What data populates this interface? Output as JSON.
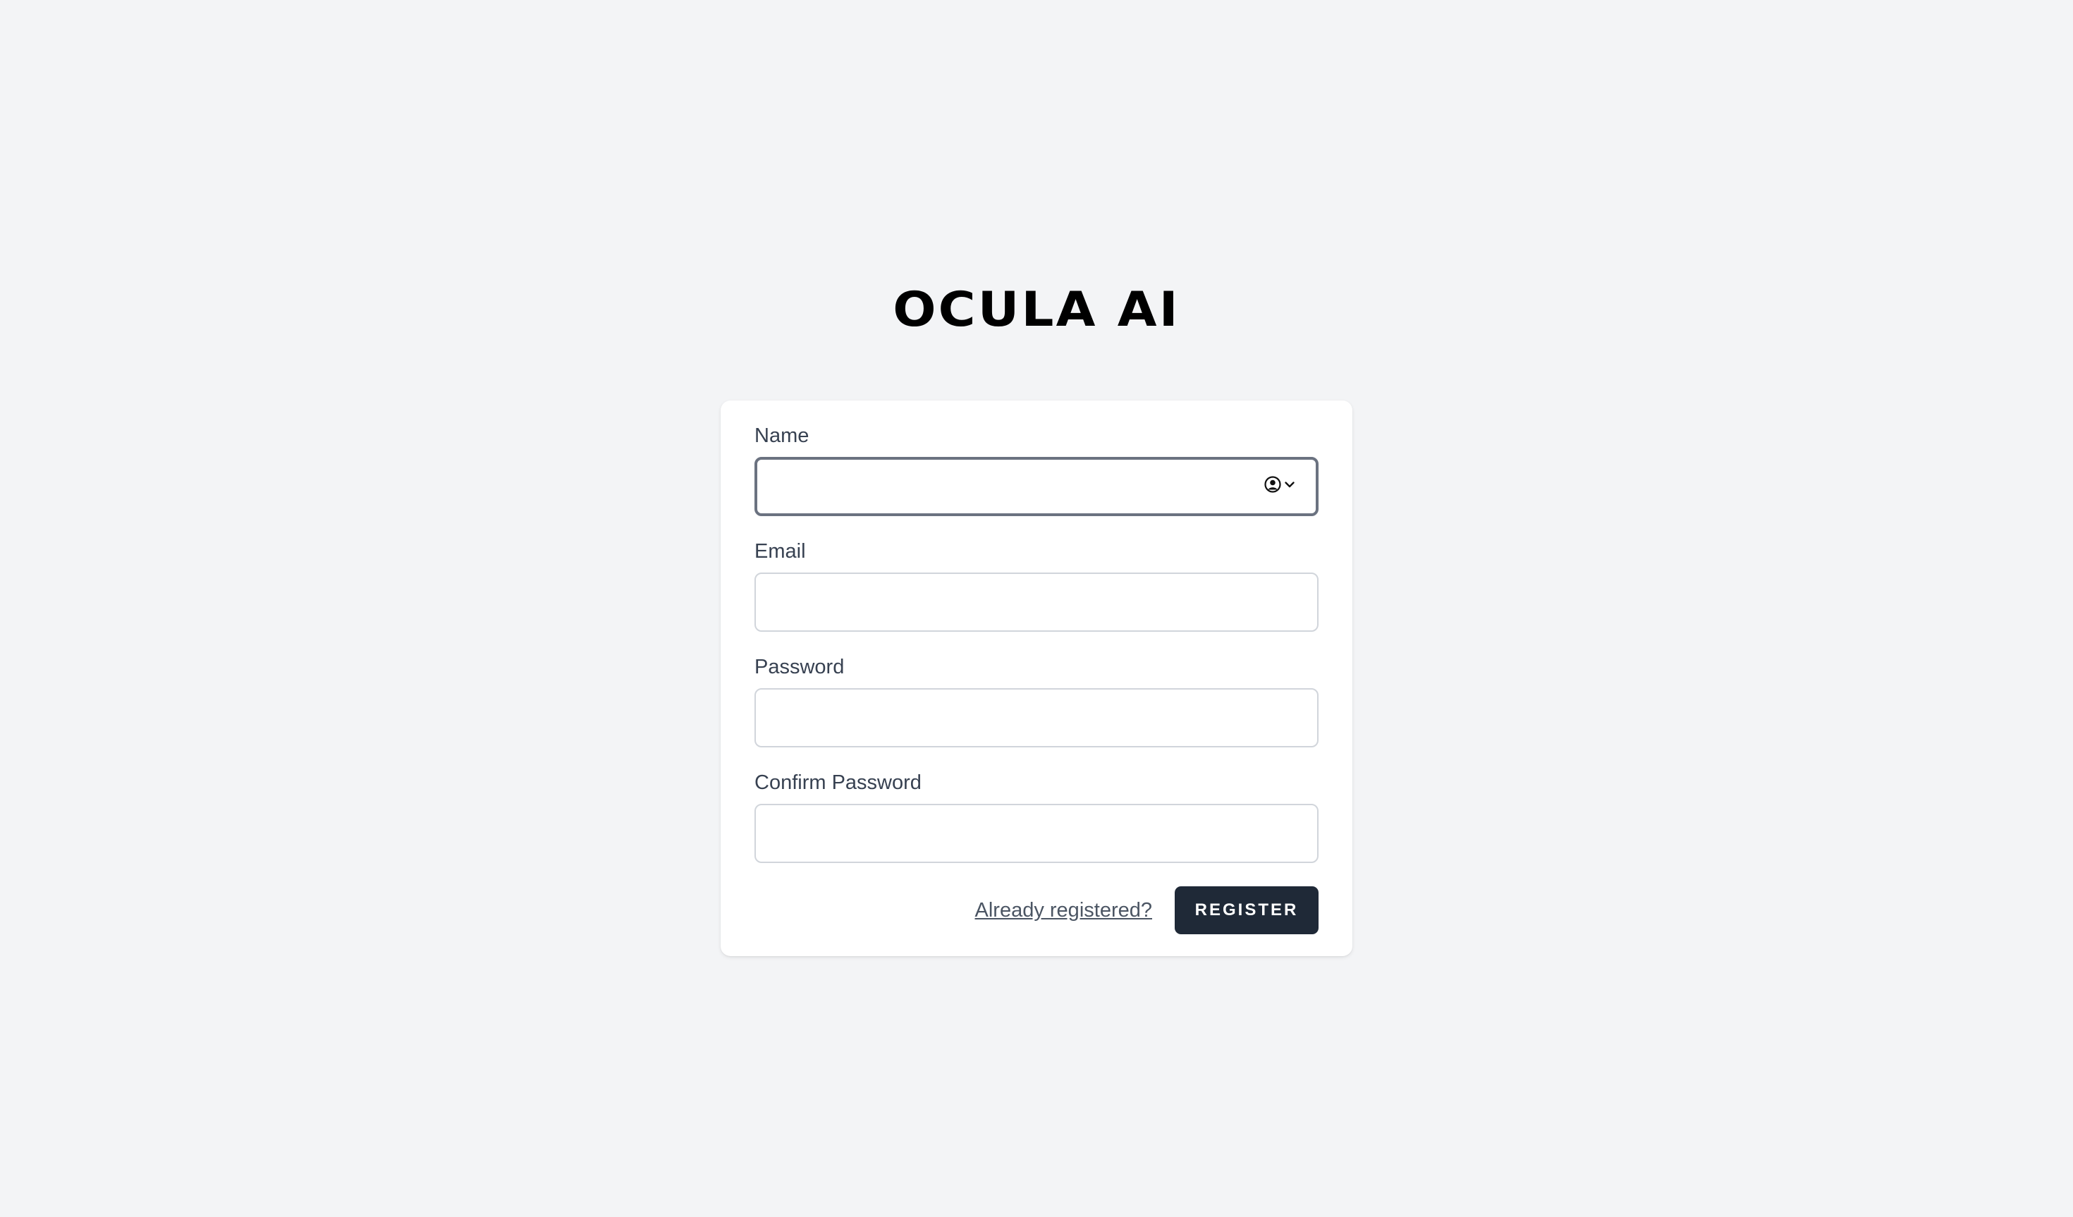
{
  "brand": {
    "logo_text": "OCULA AI"
  },
  "form": {
    "name": {
      "label": "Name",
      "value": "",
      "autofill_icon": "person-circle-icon",
      "chevron_icon": "chevron-down-icon"
    },
    "email": {
      "label": "Email",
      "value": ""
    },
    "password": {
      "label": "Password",
      "value": ""
    },
    "confirm_password": {
      "label": "Confirm Password",
      "value": ""
    },
    "already_registered_link": "Already registered?",
    "register_button": "REGISTER"
  },
  "colors": {
    "page_background": "#f3f4f6",
    "card_background": "#ffffff",
    "button_background": "#1f2937",
    "label_text": "#374151",
    "focus_border": "#6b7280",
    "input_border": "#d1d5db"
  }
}
